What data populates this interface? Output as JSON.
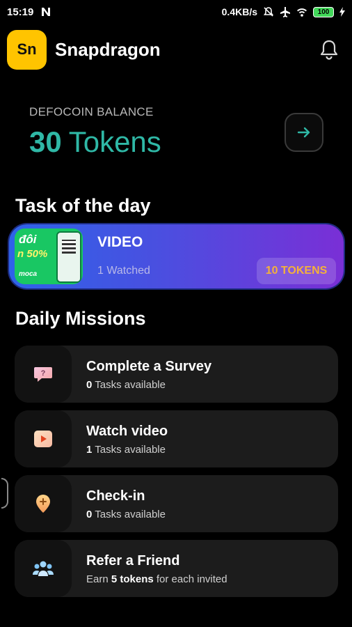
{
  "status_bar": {
    "time": "15:19",
    "net_speed": "0.4KB/s",
    "battery": "100"
  },
  "header": {
    "logo_text": "Sn",
    "app_name": "Snapdragon"
  },
  "balance": {
    "label": "DEFOCOIN BALANCE",
    "amount": "30",
    "unit": "Tokens"
  },
  "task_section": {
    "title": "Task of the day",
    "task": {
      "title": "VIDEO",
      "watched": "1 Watched",
      "reward": "10 TOKENS",
      "thumb_text_1": "đôi",
      "thumb_text_2": "n 50%",
      "thumb_text_3": "moca"
    }
  },
  "missions_section": {
    "title": "Daily Missions",
    "items": [
      {
        "title": "Complete a Survey",
        "count": "0",
        "suffix": " Tasks available",
        "prefix": "",
        "icon": "survey-icon"
      },
      {
        "title": "Watch video",
        "count": "1",
        "suffix": " Tasks available",
        "prefix": "",
        "icon": "play-icon"
      },
      {
        "title": "Check-in",
        "count": "0",
        "suffix": " Tasks available",
        "prefix": "",
        "icon": "location-pin-icon"
      },
      {
        "title": "Refer a Friend",
        "count": "5 tokens",
        "suffix": " for each invited",
        "prefix": "Earn ",
        "icon": "people-icon"
      }
    ]
  },
  "colors": {
    "accent_teal": "#2fb8a6",
    "logo_yellow": "#ffc400",
    "reward_orange": "#f4b13a",
    "card_gradient_start": "#2e63e8",
    "card_gradient_end": "#7a2fd6"
  }
}
